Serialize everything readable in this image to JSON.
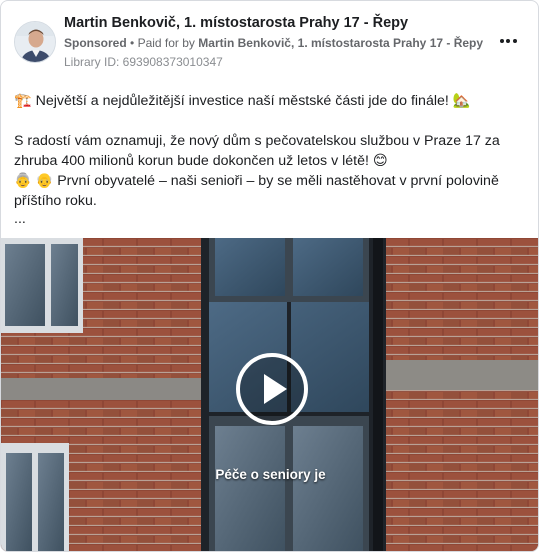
{
  "post": {
    "page_name": "Martin Benkovič, 1. místostarosta Prahy 17 - Řepy",
    "sponsored_label": "Sponsored",
    "separator": "•",
    "paid_for_prefix": "Paid for by",
    "paid_for_name": "Martin Benkovič, 1. místostarosta Prahy 17 - Řepy",
    "library_id": "Library ID: 693908373010347",
    "more_icon": "more-options-icon"
  },
  "text": {
    "line1": "🏗️ Největší a nejdůležitější investice naší městské části jde do finále! 🏡",
    "line2": "S radostí vám oznamuji, že nový dům s pečovatelskou službou v Praze 17 za",
    "line3": "zhruba 400 milionů korun bude dokončen už letos v létě! 😊",
    "line4": "👵 👴 První obyvatelé – naši senioři – by se měli nastěhovat v první polovině",
    "line5": "příštího roku.",
    "ellipsis": "..."
  },
  "video": {
    "caption": "Péče o seniory je",
    "play_icon": "play-icon"
  }
}
